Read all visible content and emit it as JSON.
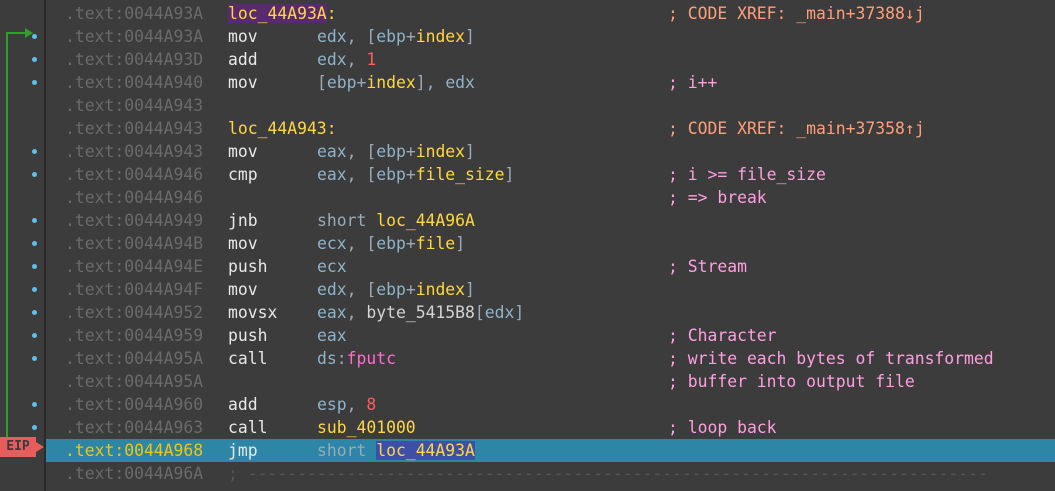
{
  "gutter": {
    "ip_label": "EIP"
  },
  "lines": [
    {
      "addr": ".text:0044A93A",
      "label": "loc_44A93A",
      "comment": "; CODE XREF: _main+37388↓j"
    },
    {
      "addr": ".text:0044A93A",
      "mn": "mov",
      "ops": [
        {
          "t": "edx",
          "c": "reg"
        },
        {
          "t": ", ["
        },
        {
          "t": "ebp",
          "c": "reg"
        },
        {
          "t": "+"
        },
        {
          "t": "index",
          "c": "var"
        },
        {
          "t": "]"
        }
      ]
    },
    {
      "addr": ".text:0044A93D",
      "mn": "add",
      "ops": [
        {
          "t": "edx",
          "c": "reg"
        },
        {
          "t": ", "
        },
        {
          "t": "1",
          "c": "num"
        }
      ]
    },
    {
      "addr": ".text:0044A940",
      "mn": "mov",
      "ops": [
        {
          "t": "["
        },
        {
          "t": "ebp",
          "c": "reg"
        },
        {
          "t": "+"
        },
        {
          "t": "index",
          "c": "var"
        },
        {
          "t": "], "
        },
        {
          "t": "edx",
          "c": "reg"
        }
      ],
      "comment": "; i++"
    },
    {
      "addr": ".text:0044A943"
    },
    {
      "addr": ".text:0044A943",
      "label": "loc_44A943",
      "comment": "; CODE XREF: _main+37358↑j"
    },
    {
      "addr": ".text:0044A943",
      "mn": "mov",
      "ops": [
        {
          "t": "eax",
          "c": "reg"
        },
        {
          "t": ", ["
        },
        {
          "t": "ebp",
          "c": "reg"
        },
        {
          "t": "+"
        },
        {
          "t": "index",
          "c": "var"
        },
        {
          "t": "]"
        }
      ]
    },
    {
      "addr": ".text:0044A946",
      "mn": "cmp",
      "ops": [
        {
          "t": "eax",
          "c": "reg"
        },
        {
          "t": ", ["
        },
        {
          "t": "ebp",
          "c": "reg"
        },
        {
          "t": "+"
        },
        {
          "t": "file_size",
          "c": "var"
        },
        {
          "t": "]"
        }
      ],
      "comment": "; i >= file_size"
    },
    {
      "addr": ".text:0044A946",
      "comment": "; => break"
    },
    {
      "addr": ".text:0044A949",
      "mn": "jnb",
      "ops": [
        {
          "t": "short "
        },
        {
          "t": "loc_44A96A",
          "c": "lab"
        }
      ]
    },
    {
      "addr": ".text:0044A94B",
      "mn": "mov",
      "ops": [
        {
          "t": "ecx",
          "c": "reg"
        },
        {
          "t": ", ["
        },
        {
          "t": "ebp",
          "c": "reg"
        },
        {
          "t": "+"
        },
        {
          "t": "file",
          "c": "var"
        },
        {
          "t": "]"
        }
      ]
    },
    {
      "addr": ".text:0044A94E",
      "mn": "push",
      "ops": [
        {
          "t": "ecx",
          "c": "reg"
        }
      ],
      "comment": "; Stream"
    },
    {
      "addr": ".text:0044A94F",
      "mn": "mov",
      "ops": [
        {
          "t": "edx",
          "c": "reg"
        },
        {
          "t": ", ["
        },
        {
          "t": "ebp",
          "c": "reg"
        },
        {
          "t": "+"
        },
        {
          "t": "index",
          "c": "var"
        },
        {
          "t": "]"
        }
      ]
    },
    {
      "addr": ".text:0044A952",
      "mn": "movsx",
      "ops": [
        {
          "t": "eax",
          "c": "reg"
        },
        {
          "t": ", "
        },
        {
          "t": "byte_5415B8",
          "c": "glb"
        },
        {
          "t": "["
        },
        {
          "t": "edx",
          "c": "reg"
        },
        {
          "t": "]"
        }
      ]
    },
    {
      "addr": ".text:0044A959",
      "mn": "push",
      "ops": [
        {
          "t": "eax",
          "c": "reg"
        }
      ],
      "comment": "; Character"
    },
    {
      "addr": ".text:0044A95A",
      "mn": "call",
      "ops": [
        {
          "t": "ds",
          "c": "reg"
        },
        {
          "t": ":"
        },
        {
          "t": "fputc",
          "c": "imp"
        }
      ],
      "comment": "; write each bytes of transformed"
    },
    {
      "addr": ".text:0044A95A",
      "comment": "; buffer into output file"
    },
    {
      "addr": ".text:0044A960",
      "mn": "add",
      "ops": [
        {
          "t": "esp",
          "c": "reg"
        },
        {
          "t": ", "
        },
        {
          "t": "8",
          "c": "num"
        }
      ]
    },
    {
      "addr": ".text:0044A963",
      "mn": "call",
      "ops": [
        {
          "t": "sub_401000",
          "c": "lab"
        }
      ],
      "comment": "; loop back"
    },
    {
      "addr": ".text:0044A968",
      "mn": "jmp",
      "ops": [
        {
          "t": "short "
        },
        {
          "t": "loc_44A93A",
          "c": "lab-hl"
        }
      ],
      "current": true
    },
    {
      "addr": ".text:0044A96A",
      "separator": "; ---------------------------------------------------------------------------"
    }
  ],
  "dots": [
    1,
    2,
    3,
    6,
    7,
    9,
    10,
    11,
    12,
    13,
    14,
    15,
    17,
    18
  ]
}
